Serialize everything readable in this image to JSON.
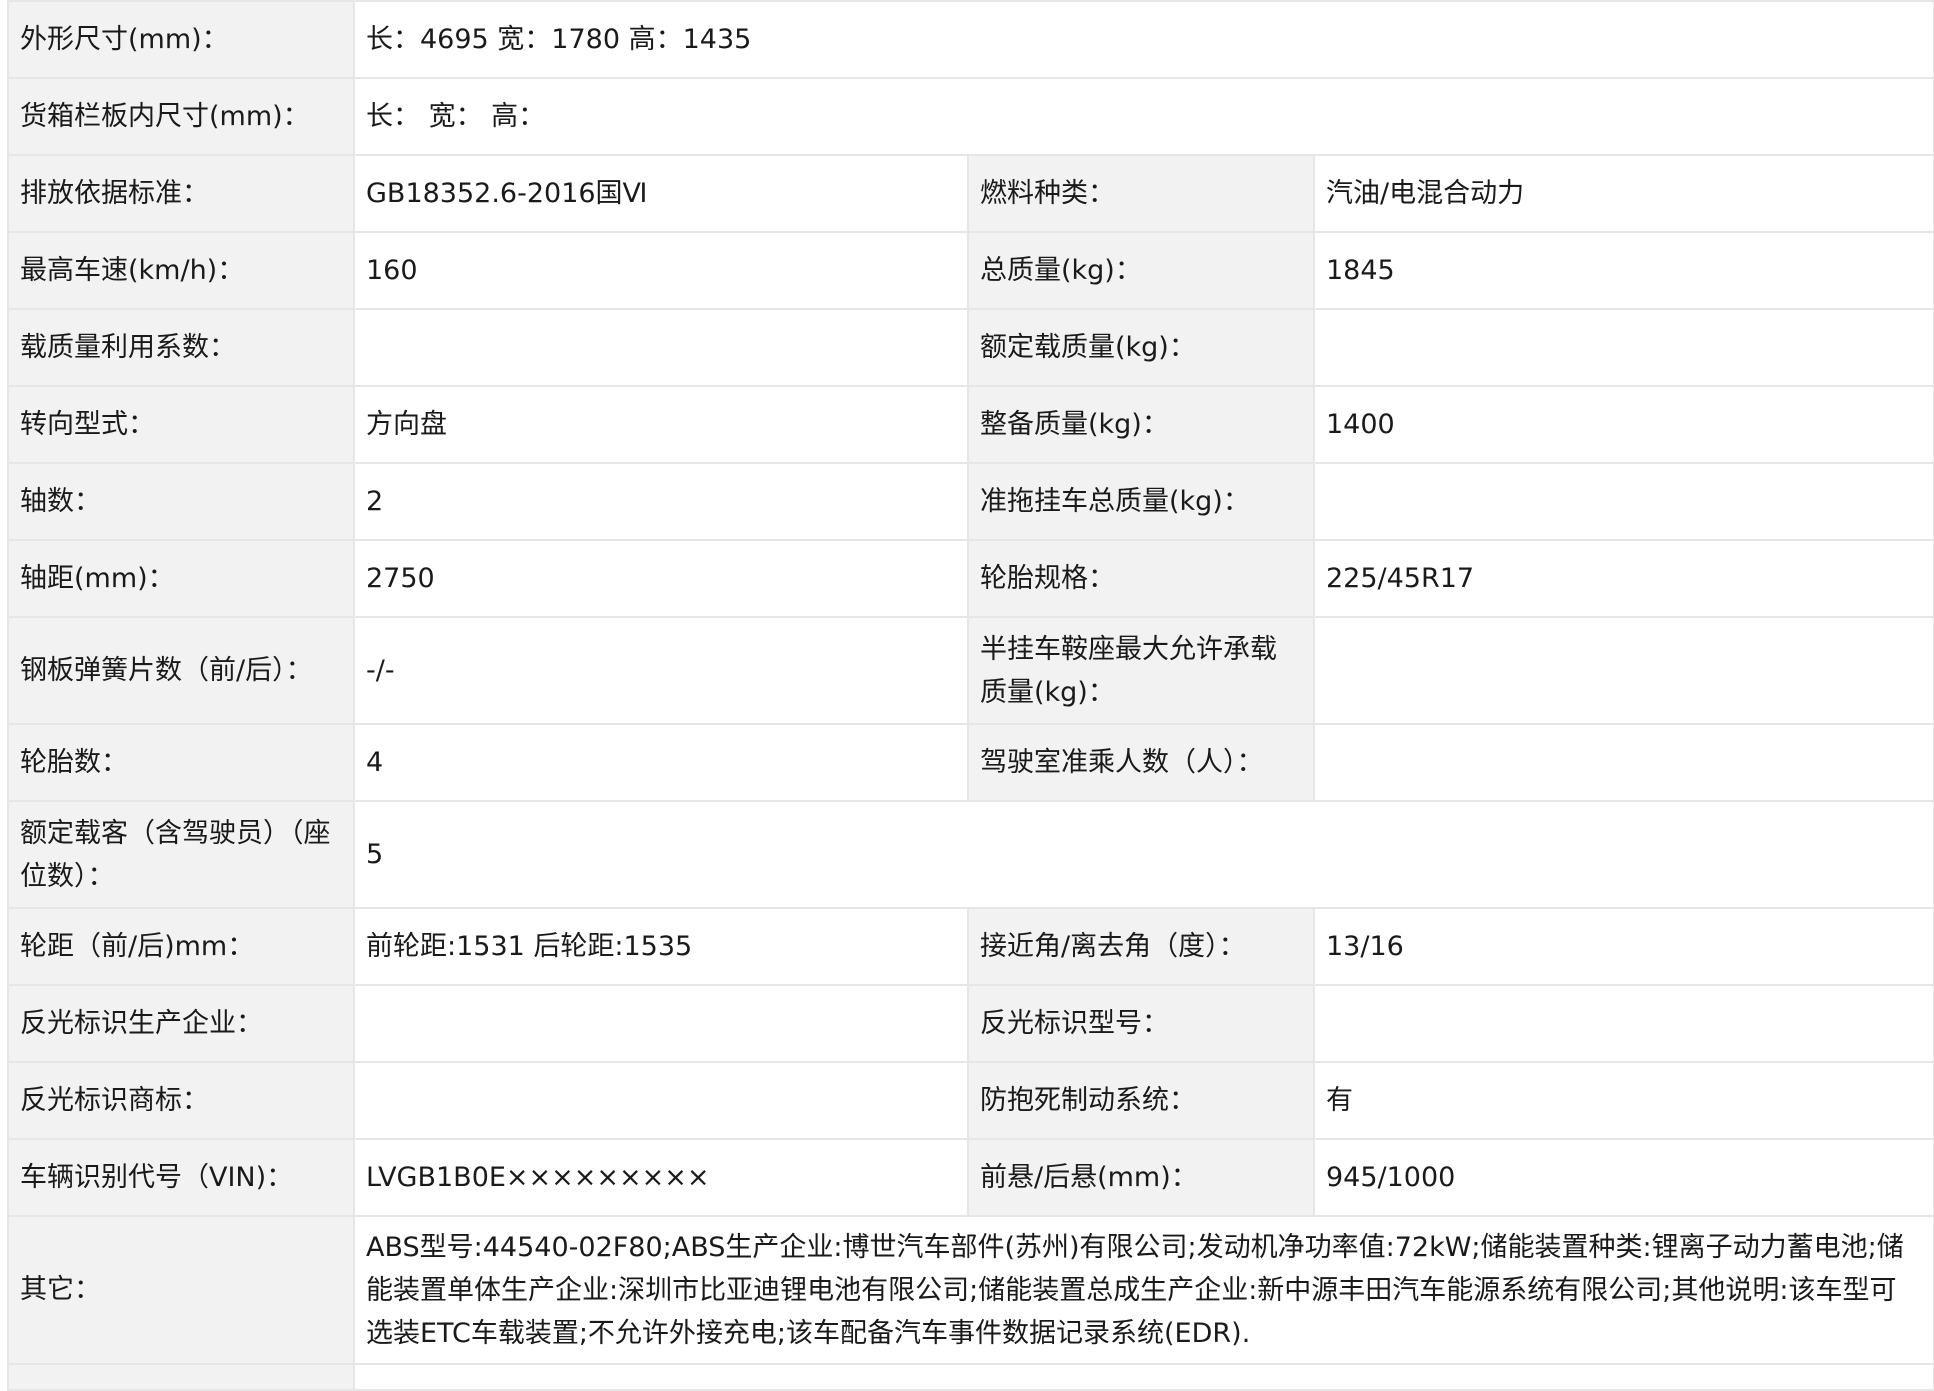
{
  "rows": [
    {
      "l1": "外形尺寸(mm)：",
      "v1": "长：4695 宽：1780 高：1435"
    },
    {
      "l1": "货箱栏板内尺寸(mm)：",
      "v1": "长： 宽： 高："
    },
    {
      "l1": "排放依据标准：",
      "v1": "GB18352.6-2016国Ⅵ",
      "l2": "燃料种类：",
      "v2": "汽油/电混合动力"
    },
    {
      "l1": "最高车速(km/h)：",
      "v1": "160",
      "l2": "总质量(kg)：",
      "v2": "1845"
    },
    {
      "l1": "载质量利用系数：",
      "v1": "",
      "l2": "额定载质量(kg)：",
      "v2": ""
    },
    {
      "l1": "转向型式：",
      "v1": "方向盘",
      "l2": "整备质量(kg)：",
      "v2": "1400"
    },
    {
      "l1": "轴数：",
      "v1": "2",
      "l2": "准拖挂车总质量(kg)：",
      "v2": ""
    },
    {
      "l1": "轴距(mm)：",
      "v1": "2750",
      "l2": "轮胎规格：",
      "v2": "225/45R17"
    },
    {
      "l1": "钢板弹簧片数（前/后）：",
      "v1": "-/-",
      "l2": "半挂车鞍座最大允许承载质量(kg)：",
      "v2": ""
    },
    {
      "l1": "轮胎数：",
      "v1": "4",
      "l2": "驾驶室准乘人数（人）：",
      "v2": ""
    },
    {
      "l1": "额定载客（含驾驶员）（座位数）：",
      "v1": "5"
    },
    {
      "l1": "轮距（前/后)mm：",
      "v1": "前轮距:1531 后轮距:1535",
      "l2": "接近角/离去角（度）：",
      "v2": "13/16"
    },
    {
      "l1": "反光标识生产企业：",
      "v1": "",
      "l2": "反光标识型号：",
      "v2": ""
    },
    {
      "l1": "反光标识商标：",
      "v1": "",
      "l2": "防抱死制动系统：",
      "v2": "有"
    },
    {
      "l1": "车辆识别代号（VIN)：",
      "v1": "LVGB1B0E×××××××××",
      "l2": "前悬/后悬(mm)：",
      "v2": "945/1000"
    },
    {
      "l1": "其它：",
      "v1": "ABS型号:44540-02F80;ABS生产企业:博世汽车部件(苏州)有限公司;发动机净功率值:72kW;储能装置种类:锂离子动力蓄电池;储能装置单体生产企业:深圳市比亚迪锂电池有限公司;储能装置总成生产企业:新中源丰田汽车能源系统有限公司;其他说明:该车型可选装ETC车载装置;不允许外接充电;该车配备汽车事件数据记录系统(EDR)."
    }
  ]
}
